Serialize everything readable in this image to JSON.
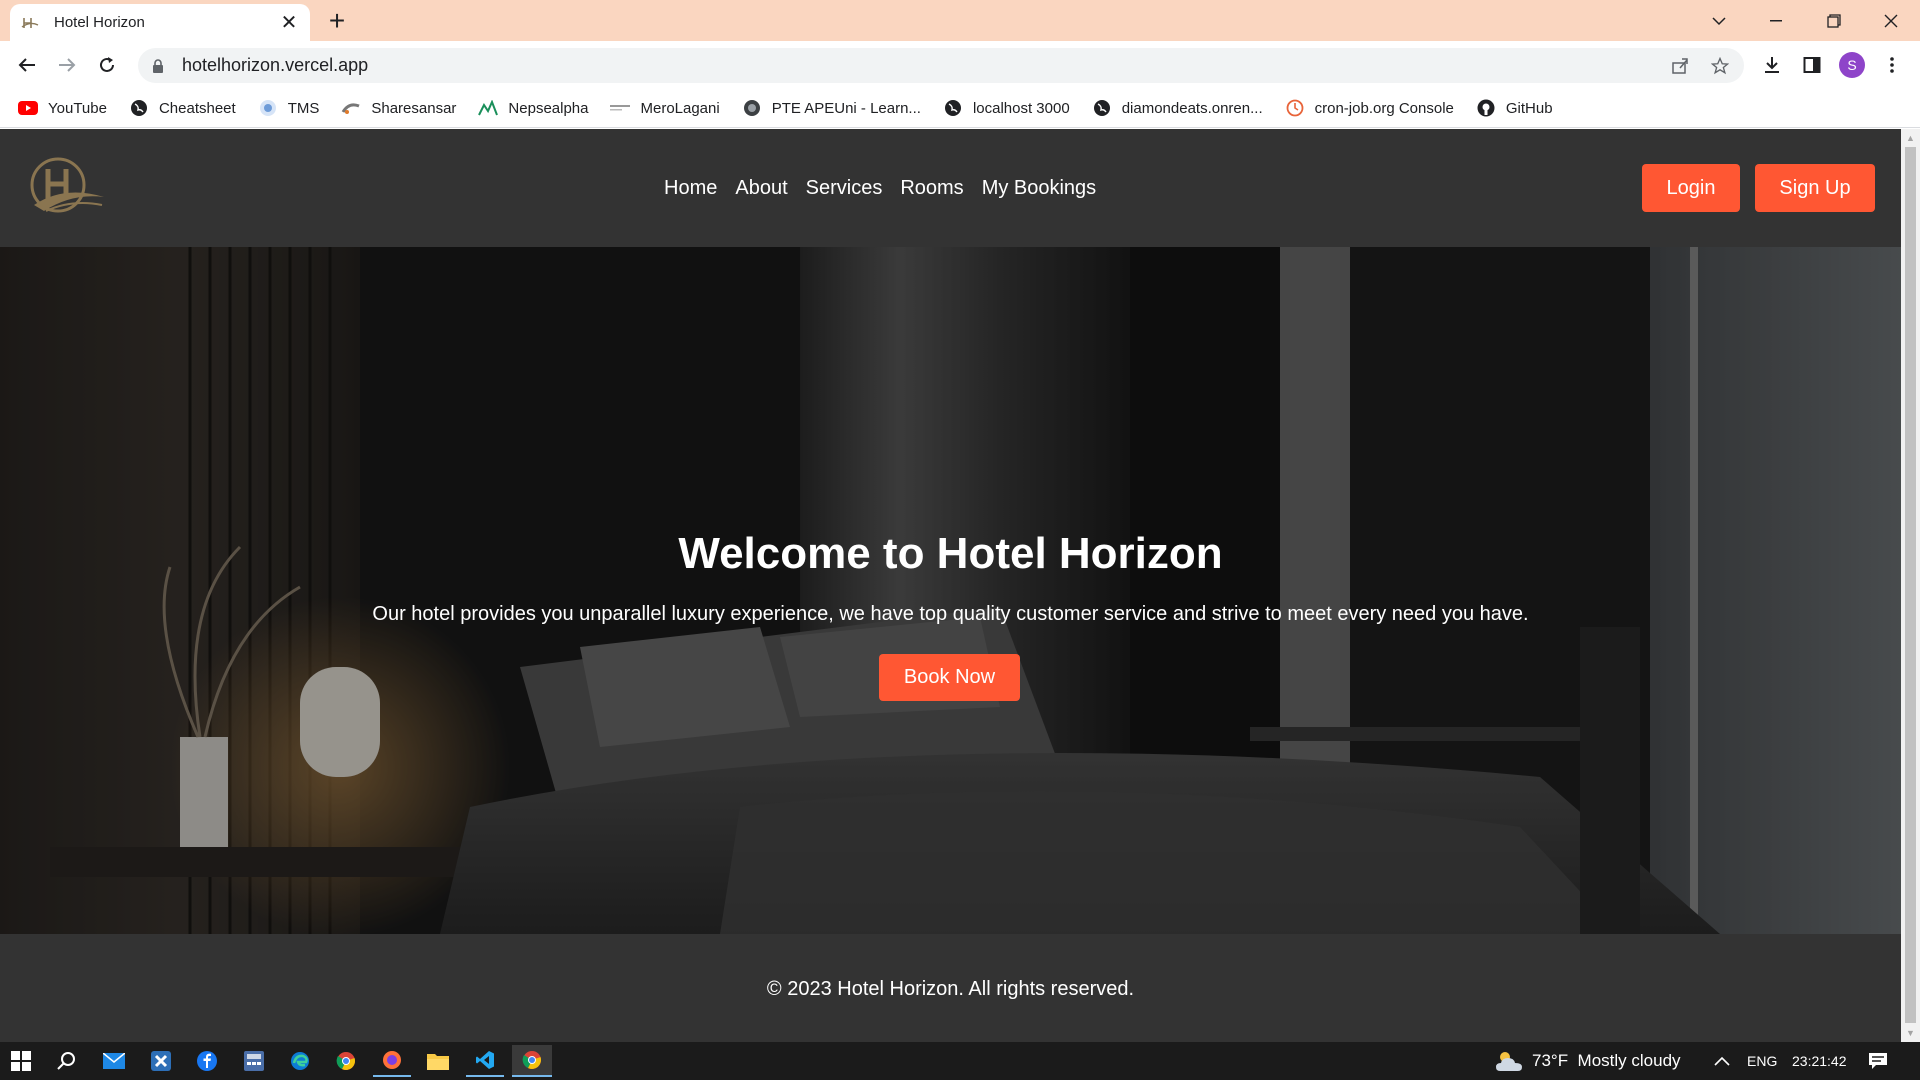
{
  "browser": {
    "tab_title": "Hotel Horizon",
    "url": "hotelhorizon.vercel.app",
    "profile_initial": "S",
    "bookmarks": [
      {
        "label": "YouTube",
        "icon": "youtube-icon"
      },
      {
        "label": "Cheatsheet",
        "icon": "globe-icon"
      },
      {
        "label": "TMS",
        "icon": "tms-icon"
      },
      {
        "label": "Sharesansar",
        "icon": "sharesansar-icon"
      },
      {
        "label": "Nepsealpha",
        "icon": "nepsealpha-icon"
      },
      {
        "label": "MeroLagani",
        "icon": "merolagani-icon"
      },
      {
        "label": "PTE APEUni - Learn...",
        "icon": "apeuni-icon"
      },
      {
        "label": "localhost 3000",
        "icon": "globe-icon"
      },
      {
        "label": "diamondeats.onren...",
        "icon": "globe-icon"
      },
      {
        "label": "cron-job.org Console",
        "icon": "cronjob-icon"
      },
      {
        "label": "GitHub",
        "icon": "github-icon"
      }
    ]
  },
  "site": {
    "nav": [
      "Home",
      "About",
      "Services",
      "Rooms",
      "My Bookings"
    ],
    "login_label": "Login",
    "signup_label": "Sign Up",
    "hero": {
      "title": "Welcome to Hotel Horizon",
      "subtitle": "Our hotel provides you unparallel luxury experience, we have top quality customer service and strive to meet every need you have.",
      "cta_label": "Book Now"
    },
    "footer": "© 2023 Hotel Horizon. All rights reserved.",
    "accent_color": "#ff5733",
    "header_color": "#333333"
  },
  "taskbar": {
    "weather": "73°F  Mostly cloudy",
    "language": "ENG",
    "time": "23:21:42"
  }
}
